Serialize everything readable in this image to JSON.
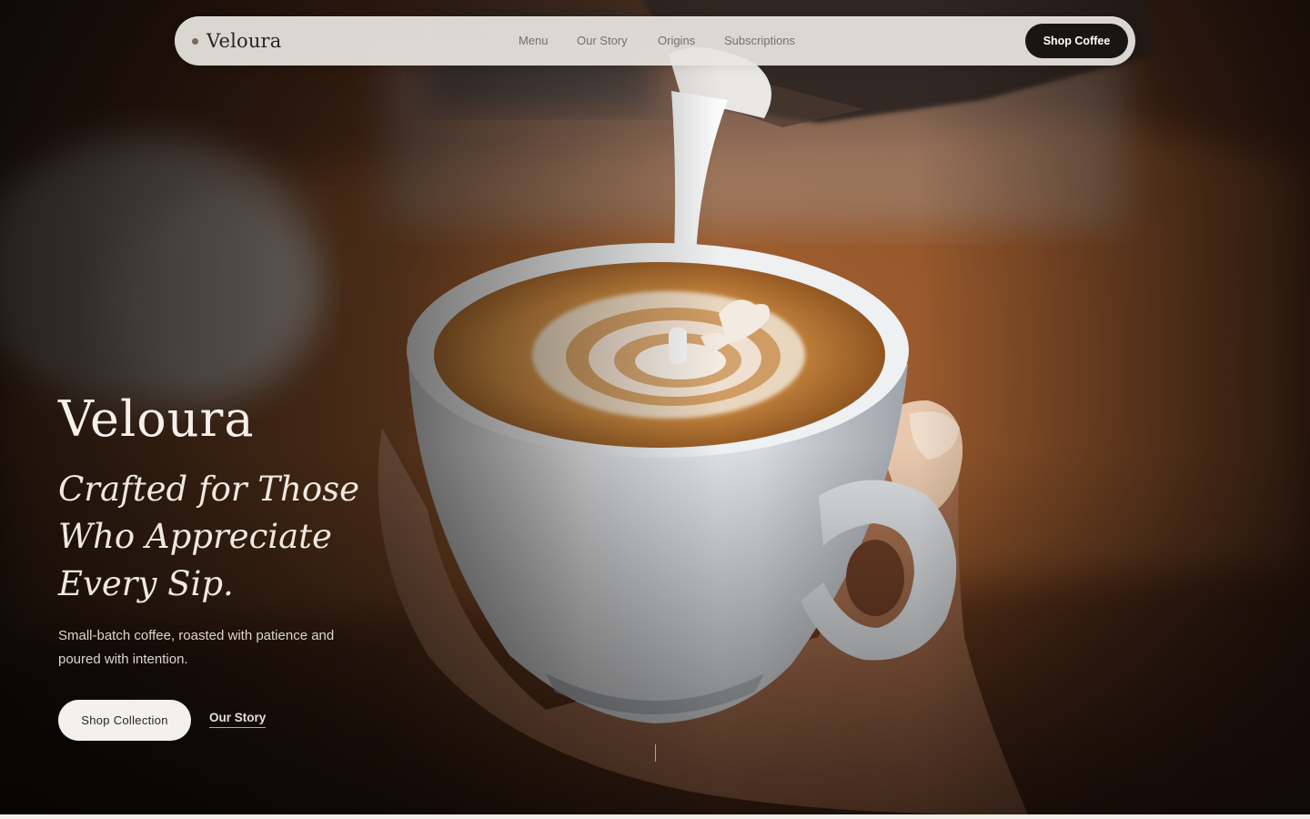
{
  "nav": {
    "brand": "Veloura",
    "links": [
      "Menu",
      "Our Story",
      "Origins",
      "Subscriptions"
    ],
    "cta": "Shop Coffee"
  },
  "hero": {
    "title": "Veloura",
    "tagline": "Crafted for Those Who Appreciate Every Sip.",
    "description": "Small-batch coffee, roasted with patience and poured with intention.",
    "primary_button": "Shop Collection",
    "secondary_link": "Our Story"
  },
  "colors": {
    "accent_dark": "#1a1512",
    "cream": "#f4f0ea",
    "coffee": "#c98a45"
  }
}
